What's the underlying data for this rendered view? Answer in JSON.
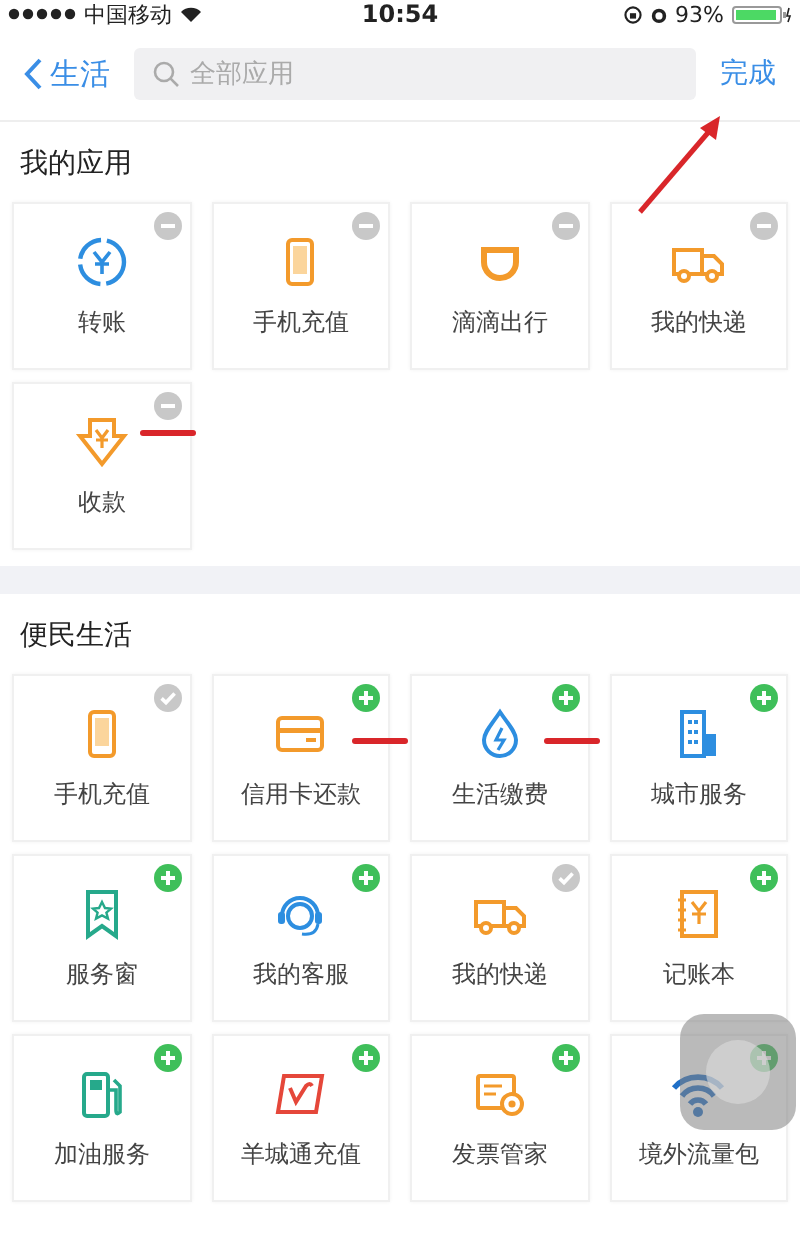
{
  "status_bar": {
    "carrier": "中国移动",
    "time": "10:54",
    "battery": "93%"
  },
  "nav": {
    "back": "生活",
    "search": {
      "placeholder": "全部应用"
    },
    "done": "完成"
  },
  "sections": [
    {
      "title": "我的应用",
      "kind": "mine",
      "apps": [
        {
          "label": "转账"
        },
        {
          "label": "手机充值"
        },
        {
          "label": "滴滴出行"
        },
        {
          "label": "我的快递"
        },
        {
          "label": "收款"
        }
      ]
    },
    {
      "title": "便民生活",
      "kind": "catalog",
      "apps": [
        {
          "label": "手机充值",
          "added": true
        },
        {
          "label": "信用卡还款",
          "added": false
        },
        {
          "label": "生活缴费",
          "added": false
        },
        {
          "label": "城市服务",
          "added": false
        },
        {
          "label": "服务窗",
          "added": false
        },
        {
          "label": "我的客服",
          "added": false
        },
        {
          "label": "我的快递",
          "added": true
        },
        {
          "label": "记账本",
          "added": false
        },
        {
          "label": "加油服务",
          "added": false
        },
        {
          "label": "羊城通充值",
          "added": false
        },
        {
          "label": "发票管家",
          "added": false
        },
        {
          "label": "境外流量包",
          "added": false
        }
      ]
    }
  ]
}
